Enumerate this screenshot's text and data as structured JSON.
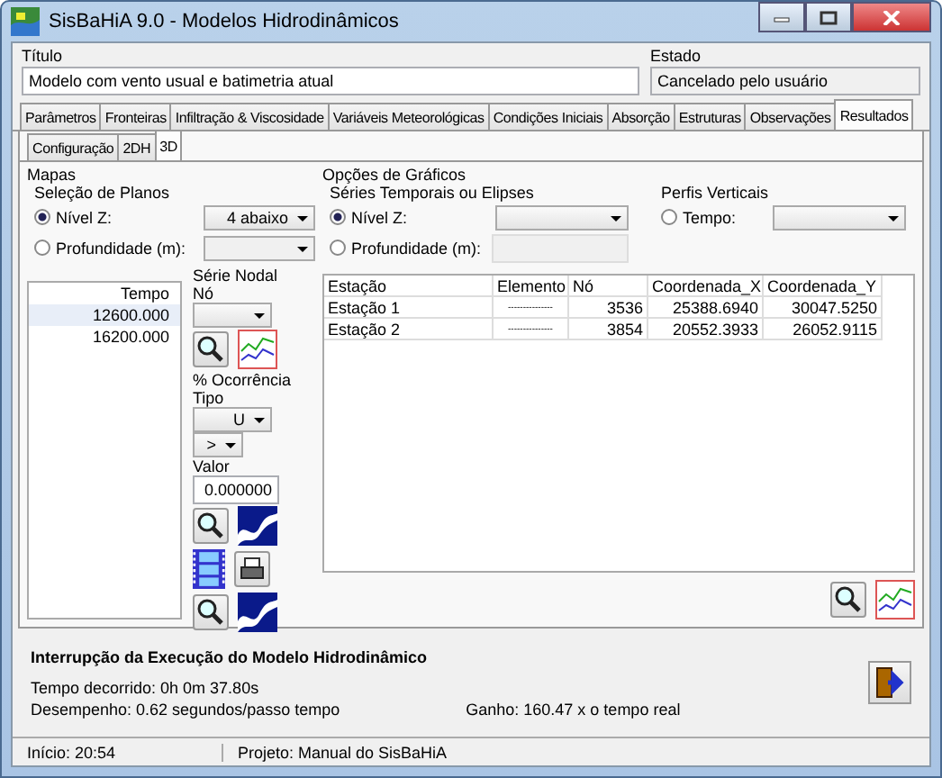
{
  "window": {
    "title": "SisBaHiA 9.0 - Modelos Hidrodinâmicos"
  },
  "title_field": {
    "label": "Título",
    "value": "Modelo com vento usual e batimetria atual"
  },
  "status_field": {
    "label": "Estado",
    "value": "Cancelado pelo usuário"
  },
  "tabs": [
    {
      "label": "Parâmetros",
      "selected": false
    },
    {
      "label": "Fronteiras",
      "selected": false
    },
    {
      "label": "Infiltração & Viscosidade",
      "selected": false
    },
    {
      "label": "Variáveis Meteorológicas",
      "selected": false
    },
    {
      "label": "Condições Iniciais",
      "selected": false
    },
    {
      "label": "Absorção",
      "selected": false
    },
    {
      "label": "Estruturas",
      "selected": false
    },
    {
      "label": "Observações",
      "selected": false
    },
    {
      "label": "Resultados",
      "selected": true
    }
  ],
  "subtabs": [
    {
      "label": "Configuração",
      "selected": false
    },
    {
      "label": "2DH",
      "selected": false
    },
    {
      "label": "3D",
      "selected": true
    }
  ],
  "maps": {
    "label": "Mapas",
    "planes_label": "Seleção de Planos",
    "options": [
      {
        "label": "Nível Z:",
        "selected": true,
        "value": "4 abaixo"
      },
      {
        "label": "Profundidade (m):",
        "selected": false
      }
    ],
    "time_column": "Tempo",
    "times": [
      "12600.000",
      "16200.000"
    ],
    "nodal_label": "Série Nodal",
    "node_label": "Nó",
    "occurrence_label": "% Ocorrência",
    "type_label": "Tipo",
    "type_value": "U",
    "operator": ">",
    "value_label": "Valor",
    "value": "0.000000"
  },
  "graphs": {
    "label": "Opções de Gráficos",
    "series_label": "Séries Temporais ou Elipses",
    "options": [
      {
        "label": "Nível Z:",
        "selected": true
      },
      {
        "label": "Profundidade (m):",
        "selected": false
      }
    ],
    "profiles_label": "Perfis Verticais",
    "profile_option": {
      "label": "Tempo:",
      "selected": false
    },
    "columns": [
      "Estação",
      "Elemento",
      "Nó",
      "Coordenada_X",
      "Coordenada_Y"
    ],
    "rows": [
      [
        "Estação 1",
        "---------------",
        "3536",
        "25388.6940",
        "30047.5250"
      ],
      [
        "Estação 2",
        "---------------",
        "3854",
        "20552.3933",
        "26052.9115"
      ]
    ]
  },
  "execution": {
    "title": "Interrupção da Execução do Modelo Hidrodinâmico",
    "elapsed": "Tempo decorrido:  0h  0m 37.80s",
    "performance": "Desempenho: 0.62 segundos/passo tempo",
    "gain": "Ganho: 160.47 x o tempo real"
  },
  "status_bar": [
    "Início: 20:54",
    "Projeto: Manual do SisBaHiA"
  ]
}
